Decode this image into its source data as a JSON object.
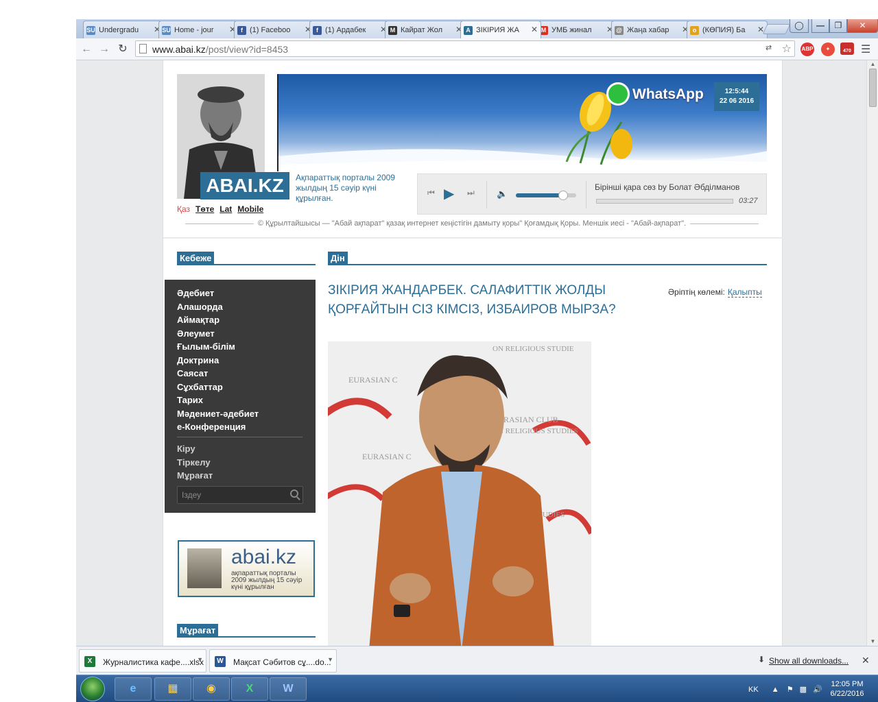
{
  "browser": {
    "tabs": [
      {
        "label": "Undergradu",
        "favicon": "SU",
        "favicon_color": "#5c8ac2",
        "active": false
      },
      {
        "label": "Home - jour",
        "favicon": "SU",
        "favicon_color": "#5c8ac2",
        "active": false
      },
      {
        "label": "(1) Faceboo",
        "favicon": "f",
        "favicon_color": "#3b5998",
        "active": false
      },
      {
        "label": "(1) Ардабек",
        "favicon": "f",
        "favicon_color": "#3b5998",
        "active": false
      },
      {
        "label": "Кайрат Жол",
        "favicon": "M",
        "favicon_color": "#333333",
        "active": false
      },
      {
        "label": "ЗІКІРИЯ ЖА",
        "favicon": "A",
        "favicon_color": "#2c6e96",
        "active": true
      },
      {
        "label": "УМБ жинал",
        "favicon": "M",
        "favicon_color": "#d93025",
        "active": false
      },
      {
        "label": "Жаңа хабар",
        "favicon": "@",
        "favicon_color": "#888888",
        "active": false
      },
      {
        "label": "(КӨПИЯ) Ба",
        "favicon": "o",
        "favicon_color": "#e2a21b",
        "active": false
      }
    ],
    "url_host": "www.abai.kz",
    "url_path": "/post/view?id=8453",
    "ext_abp": "ABP",
    "ext_badge": "470"
  },
  "site": {
    "logo": "ABAI.KZ",
    "tagline": "Ақпараттық порталы 2009 жылдың 15 сәуір күні құрылған.",
    "languages": [
      {
        "label": "Қаз",
        "current": true
      },
      {
        "label": "Төте",
        "current": false
      },
      {
        "label": "Lat",
        "current": false
      },
      {
        "label": "Mobile",
        "current": false
      }
    ],
    "banner_brand": "WhatsApp",
    "clock_time": "12:5:44",
    "clock_date": "22 06 2016",
    "player": {
      "track_title": "Бірінші қара сөз by Болат Әбділманов",
      "track_time": "03:27",
      "volume_fraction": 0.78,
      "progress_fraction": 0.0
    },
    "copyright": "© Құрылтайшысы — \"Абай ақпарат\" қазақ интернет кеңістігін дамыту қоры\" Қоғамдық Қоры. Меншік иесі - \"Абай-ақпарат\"."
  },
  "sidebar": {
    "section_title": "Кебеже",
    "categories": [
      "Әдебиет",
      "Алашорда",
      "Аймақтар",
      "Әлеумет",
      "Ғылым-білім",
      "Доктрина",
      "Саясат",
      "Сұхбаттар",
      "Тарих",
      "Мәдениет-әдебиет",
      "e-Конференция"
    ],
    "account": [
      "Кіру",
      "Тіркелу",
      "Мұрағат"
    ],
    "search_placeholder": "Іздеу",
    "ad_title": "abai.kz",
    "ad_sub": "ақпараттық порталы 2009 жылдың 15 сәуір күні құрылған",
    "archive_title": "Мұрағат"
  },
  "article": {
    "section": "Дін",
    "title": "ЗІКІРИЯ ЖАНДАРБЕК. САЛАФИТТІК ЖОЛДЫ ҚОРҒАЙТЫН СІЗ КІМСІЗ, ИЗБАИРОВ МЫРЗА?",
    "font_size_label": "Әріптің көлемі:",
    "font_size_value": "Қалыпты",
    "photo_wall_text_1": "EURASIAN CLUB",
    "photo_wall_text_2": "ON RELIGIOUS STUDIES"
  },
  "downloads": {
    "items": [
      {
        "name": "Журналистика кафе....xlsx",
        "icon": "X",
        "color": "#1f7a3a"
      },
      {
        "name": "Мақсат Сәбитов сұ....do...",
        "icon": "W",
        "color": "#2b5797"
      }
    ],
    "show_all": "Show all downloads..."
  },
  "taskbar": {
    "lang": "KK",
    "time": "12:05 PM",
    "date": "6/22/2016"
  },
  "colors": {
    "accent": "#2c6e96",
    "menu_bg": "#3a3a3a"
  }
}
